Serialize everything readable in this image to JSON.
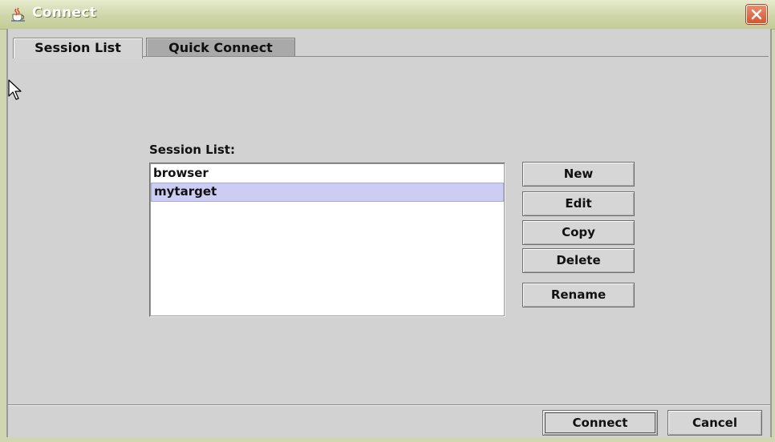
{
  "window": {
    "title": "Connect",
    "icons": {
      "app": "java-cup-icon",
      "close": "close-icon"
    }
  },
  "tabs": [
    {
      "label": "Session List",
      "active": true
    },
    {
      "label": "Quick Connect",
      "active": false
    }
  ],
  "session_list": {
    "label": "Session List:",
    "items": [
      {
        "label": "browser",
        "selected": false
      },
      {
        "label": "mytarget",
        "selected": true
      }
    ]
  },
  "buttons": {
    "new": "New",
    "edit": "Edit",
    "copy": "Copy",
    "delete": "Delete",
    "rename": "Rename"
  },
  "footer": {
    "connect": "Connect",
    "cancel": "Cancel"
  },
  "colors": {
    "title_bar": "#cdd5a6",
    "close_button": "#d8552f",
    "selection": "#cdcdf3"
  }
}
